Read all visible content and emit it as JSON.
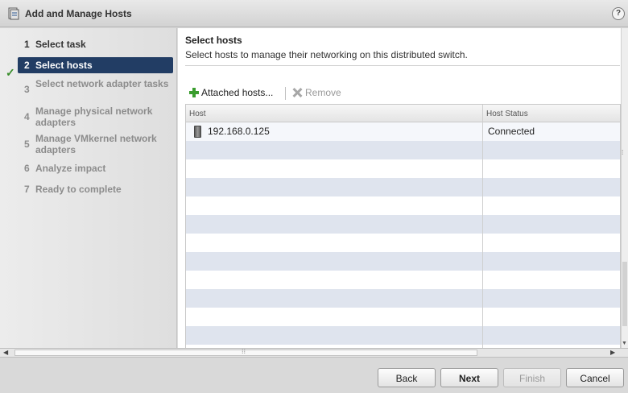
{
  "window": {
    "title": "Add and Manage Hosts",
    "help_label": "?"
  },
  "sidebar": {
    "steps": [
      {
        "number": "1",
        "label": "Select task"
      },
      {
        "number": "2",
        "label": "Select hosts"
      },
      {
        "number": "3",
        "label": "Select network adapter tasks"
      },
      {
        "number": "4",
        "label": "Manage physical network adapters"
      },
      {
        "number": "5",
        "label": "Manage VMkernel network adapters"
      },
      {
        "number": "6",
        "label": "Analyze impact"
      },
      {
        "number": "7",
        "label": "Ready to complete"
      }
    ]
  },
  "main": {
    "heading": "Select hosts",
    "description": "Select hosts to manage their networking on this distributed switch.",
    "toolbar": {
      "attach_label": "Attached hosts...",
      "remove_label": "Remove"
    },
    "table": {
      "columns": [
        "Host",
        "Host Status"
      ],
      "rows": [
        {
          "host": "192.168.0.125",
          "status": "Connected"
        }
      ]
    }
  },
  "footer": {
    "back": "Back",
    "next": "Next",
    "finish": "Finish",
    "cancel": "Cancel"
  },
  "colors": {
    "active_step": "#223d64",
    "check": "#3a8e2c",
    "add_icon": "#3a9d2e",
    "stripe": "#dfe4ee"
  }
}
